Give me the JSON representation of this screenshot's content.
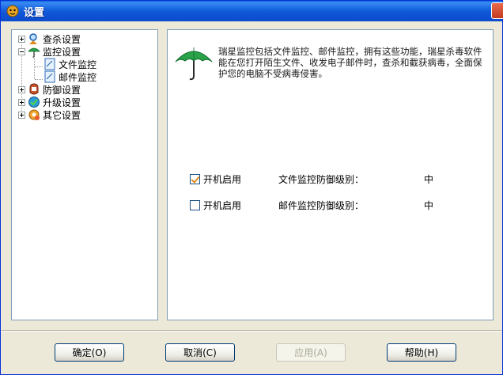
{
  "window": {
    "title": "设置"
  },
  "tree": {
    "items": [
      {
        "label": "查杀设置"
      },
      {
        "label": "监控设置"
      },
      {
        "label": "文件监控"
      },
      {
        "label": "邮件监控"
      },
      {
        "label": "防御设置"
      },
      {
        "label": "升级设置"
      },
      {
        "label": "其它设置"
      }
    ]
  },
  "content": {
    "description": "瑞星监控包括文件监控、邮件监控，拥有这些功能，瑞星杀毒软件能在您打开陌生文件、收发电子邮件时，查杀和截获病毒，全面保护您的电脑不受病毒侵害。",
    "file_monitor": {
      "checkbox_label": "开机启用",
      "checked": true,
      "level_label": "文件监控防御级别：",
      "level_value": "中"
    },
    "mail_monitor": {
      "checkbox_label": "开机启用",
      "checked": false,
      "level_label": "邮件监控防御级别：",
      "level_value": "中"
    }
  },
  "buttons": {
    "ok": "确定(O)",
    "cancel": "取消(C)",
    "apply": "应用(A)",
    "help": "帮助(H)"
  },
  "colors": {
    "titlebar": "#0f56d6",
    "window_bg": "#ece9d8",
    "check_mark": "#e08a1c"
  }
}
